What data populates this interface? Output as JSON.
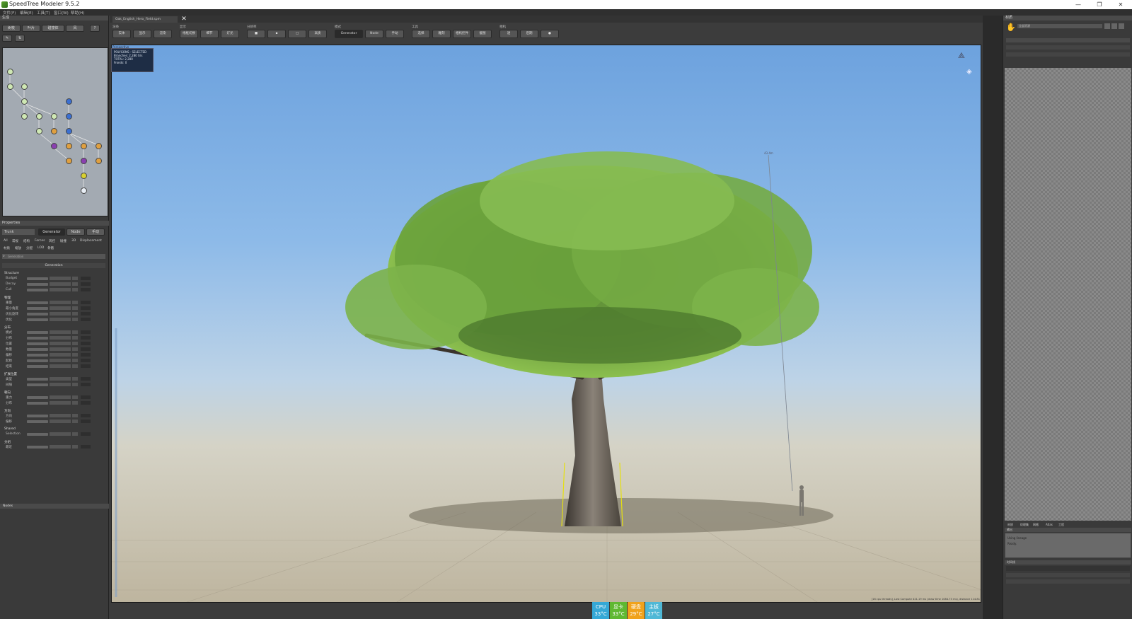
{
  "window": {
    "title": "SpeedTree  Modeler 9.5.2",
    "controls": {
      "minimize": "—",
      "restore": "❐",
      "close": "✕"
    }
  },
  "menubar": {
    "items": [
      "文件(F)",
      "编辑(E)",
      "工具(T)",
      "窗口(W)",
      "帮助(H)"
    ]
  },
  "document": {
    "tab_name": "Oak_English_Hero_Field.spm",
    "close": "✕"
  },
  "toolbar": {
    "groups": [
      {
        "label": "渲染",
        "buttons": [
          "实体",
          "显示",
          "渲染"
        ]
      },
      {
        "label": "显示",
        "buttons": [
          "线框切换",
          "细节",
          "灯光"
        ]
      },
      {
        "label": "分辨率",
        "buttons": [
          "■",
          "▪",
          "□",
          "高质"
        ]
      },
      {
        "label": "模式",
        "buttons": [
          "Generator",
          "Node",
          "手动"
        ]
      },
      {
        "label": "工具",
        "buttons": [
          "选择",
          "雕刻",
          "相机控件",
          "截图"
        ]
      },
      {
        "label": "相机",
        "buttons": [
          "透",
          "后期",
          "●"
        ]
      }
    ]
  },
  "left_panel": {
    "scene_header": "生成",
    "scene_buttons": [
      "树枝",
      "叶片",
      "碰撞体",
      "风",
      "?"
    ],
    "properties_header": "Properties",
    "object_name": "Trunk",
    "mode_tabs": [
      "Generator",
      "Node",
      "手动"
    ],
    "filter_tabs": [
      "All",
      "常规",
      "结构",
      "Forces",
      "风控",
      "碰撞",
      "3D",
      "Displacement"
    ],
    "filter_tabs2": [
      "材质",
      "缩放",
      "分配",
      "LOD",
      "骨骼"
    ],
    "search_placeholder": "Generation",
    "group_title": "Generation",
    "rows": [
      {
        "section": "Structure",
        "labels": [
          "Budget",
          "Decay",
          "Cull"
        ]
      },
      {
        "section": "物理",
        "labels": [
          "重量",
          "最小角度",
          "优化旋转",
          "优化"
        ]
      },
      {
        "section": "分布",
        "labels": [
          "模式",
          "分布",
          "位置",
          "数量",
          "偏移",
          "起始",
          "结束"
        ]
      },
      {
        "section": "扩展位置",
        "labels": [
          "类型",
          "间隔"
        ]
      },
      {
        "section": "朝向",
        "labels": [
          "重力",
          "分布"
        ]
      },
      {
        "section": "方向",
        "labels": [
          "方向",
          "偏移"
        ]
      },
      {
        "section": "Shared",
        "labels": [
          "Selection"
        ]
      },
      {
        "section": "分组",
        "labels": [
          "最近"
        ]
      }
    ],
    "nodes_header": "Nodes"
  },
  "viewport": {
    "view_name": "Perspective",
    "stats": {
      "heading": "POLYGONS - SELECTED",
      "branches": "Branches: 2,280 tris",
      "total": "TOTAL: 2,280",
      "fronds": "Fronds: 0"
    },
    "height_label": "43.4m",
    "status": "[16 cpu threads], Last Compute 421.19 ms (draw time 1084.73 ms), distance 114.81"
  },
  "hw_monitor": [
    {
      "label": "CPU",
      "value": "33°C",
      "color": "#35a8d6"
    },
    {
      "label": "显卡",
      "value": "33°C",
      "color": "#5fb832"
    },
    {
      "label": "硬盘",
      "value": "29°C",
      "color": "#f0a21c"
    },
    {
      "label": "主板",
      "value": "27°C",
      "color": "#4fb8d6"
    }
  ],
  "right_panel": {
    "header": "材质",
    "title": "资源浏览器",
    "dropdown": "全部资源",
    "bottom_tabs": [
      "材质",
      "纹理集",
      "网格",
      "Atlas",
      "工程"
    ],
    "log_header": "输出",
    "log_lines": [
      "Using lineage",
      "Ready."
    ],
    "timeline_header": "时间线"
  }
}
